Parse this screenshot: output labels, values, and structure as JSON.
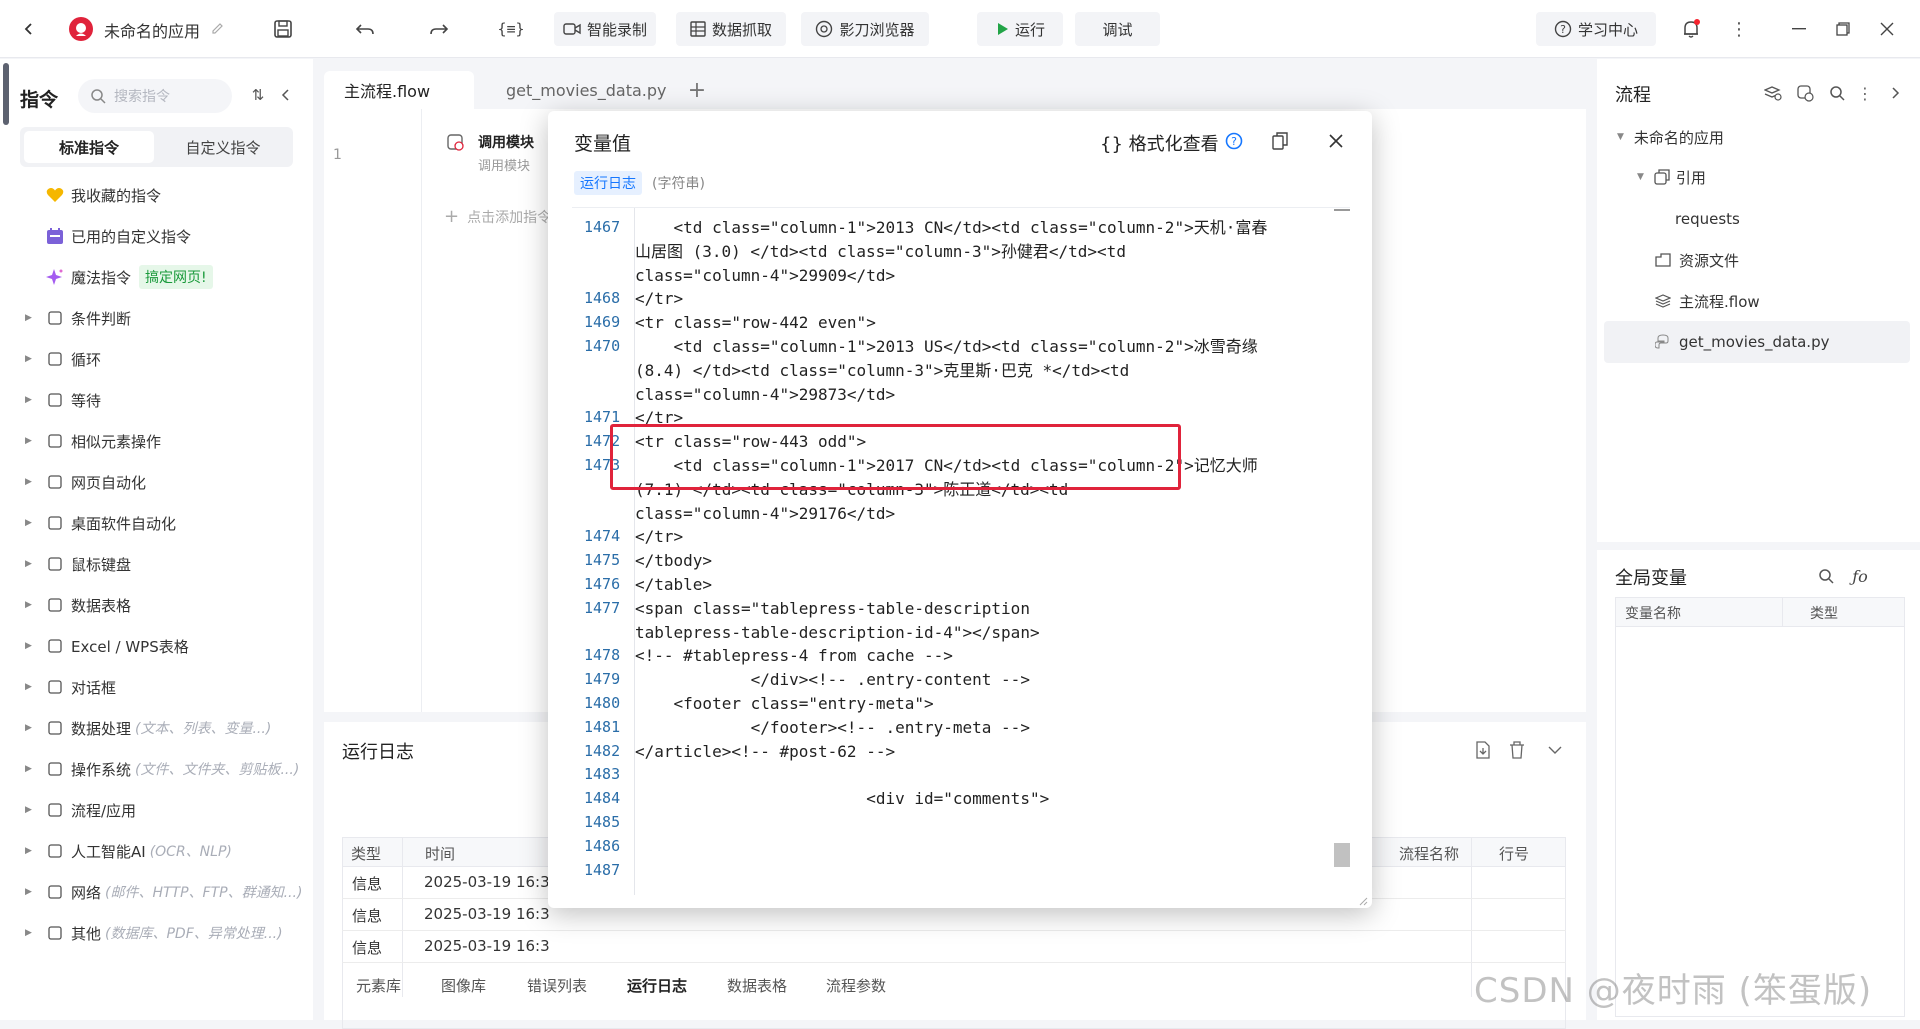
{
  "topbar": {
    "app_title": "未命名的应用",
    "btn_record": "智能录制",
    "btn_capture": "数据抓取",
    "btn_browser": "影刀浏览器",
    "btn_run": "运行",
    "btn_debug": "调试",
    "btn_learn": "学习中心"
  },
  "left": {
    "title": "指令",
    "search_placeholder": "搜索指令",
    "tab_standard": "标准指令",
    "tab_custom": "自定义指令",
    "fav": "我收藏的指令",
    "used_custom": "已用的自定义指令",
    "magic": "魔法指令",
    "magic_badge": "搞定网页!",
    "items": [
      {
        "label": "条件判断",
        "hint": ""
      },
      {
        "label": "循环",
        "hint": ""
      },
      {
        "label": "等待",
        "hint": ""
      },
      {
        "label": "相似元素操作",
        "hint": ""
      },
      {
        "label": "网页自动化",
        "hint": ""
      },
      {
        "label": "桌面软件自动化",
        "hint": ""
      },
      {
        "label": "鼠标键盘",
        "hint": ""
      },
      {
        "label": "数据表格",
        "hint": ""
      },
      {
        "label": "Excel / WPS表格",
        "hint": ""
      },
      {
        "label": "对话框",
        "hint": ""
      },
      {
        "label": "数据处理",
        "hint": "(文本、列表、变量...)"
      },
      {
        "label": "操作系统",
        "hint": "(文件、文件夹、剪贴板...)"
      },
      {
        "label": "流程/应用",
        "hint": ""
      },
      {
        "label": "人工智能AI",
        "hint": "(OCR、NLP)"
      },
      {
        "label": "网络",
        "hint": "(邮件、HTTP、FTP、群通知...)"
      },
      {
        "label": "其他",
        "hint": "(数据库、PDF、异常处理...)"
      }
    ]
  },
  "editor": {
    "tab1": "主流程.flow",
    "tab2": "get_movies_data.py",
    "line_no": "1",
    "block_title": "调用模块",
    "block_sub": "调用模块",
    "add_hint": "点击添加指令"
  },
  "log": {
    "title": "运行日志",
    "headers": [
      "类型",
      "时间",
      "流程名称",
      "行号"
    ],
    "rows": [
      {
        "type": "信息",
        "time": "2025-03-19 16:3"
      },
      {
        "type": "信息",
        "time": "2025-03-19 16:3"
      },
      {
        "type": "信息",
        "time": "2025-03-19 16:3"
      }
    ]
  },
  "bottom_tabs": [
    "元素库",
    "图像库",
    "错误列表",
    "运行日志",
    "数据表格",
    "流程参数"
  ],
  "modal": {
    "title": "变量值",
    "format_view": "{} 格式化查看",
    "var_tag": "运行日志",
    "var_type": "(字符串)",
    "lines": [
      {
        "n": "1467",
        "t": "    <td class=\"column-1\">2013 CN</td><td class=\"column-2\">天机·富春"
      },
      {
        "n": "",
        "t": "山居图 (3.0) </td><td class=\"column-3\">孙健君</td><td"
      },
      {
        "n": "",
        "t": "class=\"column-4\">29909</td>"
      },
      {
        "n": "1468",
        "t": "</tr>"
      },
      {
        "n": "1469",
        "t": "<tr class=\"row-442 even\">"
      },
      {
        "n": "1470",
        "t": "    <td class=\"column-1\">2013 US</td><td class=\"column-2\">冰雪奇缘"
      },
      {
        "n": "",
        "t": "(8.4) </td><td class=\"column-3\">克里斯·巴克 *</td><td"
      },
      {
        "n": "",
        "t": "class=\"column-4\">29873</td>"
      },
      {
        "n": "1471",
        "t": "</tr>"
      },
      {
        "n": "1472",
        "t": "<tr class=\"row-443 odd\">"
      },
      {
        "n": "1473",
        "t": "    <td class=\"column-1\">2017 CN</td><td class=\"column-2\">记忆大师"
      },
      {
        "n": "",
        "t": "(7.1) </td><td class=\"column-3\">陈正道</td><td"
      },
      {
        "n": "",
        "t": "class=\"column-4\">29176</td>"
      },
      {
        "n": "1474",
        "t": "</tr>"
      },
      {
        "n": "1475",
        "t": "</tbody>"
      },
      {
        "n": "1476",
        "t": "</table>"
      },
      {
        "n": "1477",
        "t": "<span class=\"tablepress-table-description"
      },
      {
        "n": "",
        "t": "tablepress-table-description-id-4\"></span>"
      },
      {
        "n": "1478",
        "t": "<!-- #tablepress-4 from cache -->"
      },
      {
        "n": "1479",
        "t": "            </div><!-- .entry-content -->"
      },
      {
        "n": "1480",
        "t": "    <footer class=\"entry-meta\">"
      },
      {
        "n": "1481",
        "t": "            </footer><!-- .entry-meta -->"
      },
      {
        "n": "1482",
        "t": "</article><!-- #post-62 -->"
      },
      {
        "n": "1483",
        "t": ""
      },
      {
        "n": "1484",
        "t": "                        <div id=\"comments\">"
      },
      {
        "n": "1485",
        "t": ""
      },
      {
        "n": "1486",
        "t": ""
      },
      {
        "n": "1487",
        "t": ""
      }
    ]
  },
  "right": {
    "flow_title": "流程",
    "app_name": "未命名的应用",
    "ref": "引用",
    "requests": "requests",
    "resources": "资源文件",
    "main_flow": "主流程.flow",
    "py_file": "get_movies_data.py",
    "global_vars": "全局变量",
    "col_name": "变量名称",
    "col_type": "类型"
  },
  "watermark": "CSDN @夜时雨 (笨蛋版)",
  "colors": {
    "accent": "#1677ff",
    "highlight_box": "#e0233b",
    "magic_badge_bg": "#e6f7e9",
    "magic_badge_fg": "#1a9a3b"
  }
}
